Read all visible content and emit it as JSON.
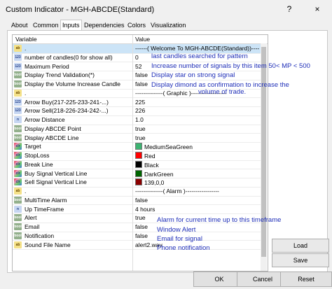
{
  "window": {
    "title": "Custom Indicator - MGH-ABCDE(Standard)",
    "help_glyph": "?",
    "close_glyph": "×"
  },
  "tabs": [
    "About",
    "Common",
    "Inputs",
    "Dependencies",
    "Colors",
    "Visualization"
  ],
  "active_tab": "Inputs",
  "grid": {
    "headers": {
      "variable": "Variable",
      "value": "Value"
    },
    "rows": [
      {
        "icon": "ab",
        "name": ".",
        "value": "------( Welcome To MGH-ABCDE(Standard))----"
      },
      {
        "icon": "123",
        "name": "number of candles(0 for show all)",
        "value": "0"
      },
      {
        "icon": "123",
        "name": "Maximum Period",
        "value": "52"
      },
      {
        "icon": "bool",
        "name": "Display Trend Validation(*)",
        "value": "false"
      },
      {
        "icon": "bool",
        "name": "Display the Volume Increase Candle",
        "value": "false"
      },
      {
        "icon": "ab",
        "name": ".",
        "value": "--------------( Graphic )------------------"
      },
      {
        "icon": "123",
        "name": "Arrow Buy(217-225-233-241-...)",
        "value": "225"
      },
      {
        "icon": "123",
        "name": "Arrow Sell(218-226-234-242-...)",
        "value": "226"
      },
      {
        "icon": "n",
        "name": "Arrow Distance",
        "value": "1.0"
      },
      {
        "icon": "bool",
        "name": "Display ABCDE Point",
        "value": "true"
      },
      {
        "icon": "bool",
        "name": "Display ABCDE Line",
        "value": "true"
      },
      {
        "icon": "clr",
        "name": "Target",
        "value": "MediumSeaGreen",
        "swatch": "#3cb371"
      },
      {
        "icon": "clr",
        "name": "StopLoss",
        "value": "Red",
        "swatch": "#ff0000"
      },
      {
        "icon": "clr",
        "name": "Break Line",
        "value": "Black",
        "swatch": "#000000"
      },
      {
        "icon": "clr",
        "name": "Buy Signal Vertical Line",
        "value": "DarkGreen",
        "swatch": "#006400"
      },
      {
        "icon": "clr",
        "name": "Sell Signal Vertical Line",
        "value": "139,0,0",
        "swatch": "#8b0000"
      },
      {
        "icon": "ab",
        "name": ".",
        "value": "--------------( Alarm )-----------------"
      },
      {
        "icon": "bool",
        "name": "MultiTime Alarm",
        "value": "false"
      },
      {
        "icon": "n",
        "name": "Up TimeFrame",
        "value": "4 hours"
      },
      {
        "icon": "bool",
        "name": "Alert",
        "value": "true"
      },
      {
        "icon": "bool",
        "name": "Email",
        "value": "false"
      },
      {
        "icon": "bool",
        "name": "Notification",
        "value": "false"
      },
      {
        "icon": "ab",
        "name": "Sound File Name",
        "value": "alert2.wav"
      }
    ]
  },
  "annotations": {
    "a1": "last candles searched for pattern",
    "a2": "Increase number of signals by this item  50< MP < 500",
    "a3": "Display star on strong signal",
    "a4a": "Display dimond as confirmation to increase the",
    "a4b": "volume of trade.",
    "a5": "Alarm for current time up to this timeframe",
    "a6": "Window Alert",
    "a7": "Email for signal",
    "a8": "Phone notification"
  },
  "buttons": {
    "load": "Load",
    "save": "Save",
    "ok": "OK",
    "cancel": "Cancel",
    "reset": "Reset"
  }
}
